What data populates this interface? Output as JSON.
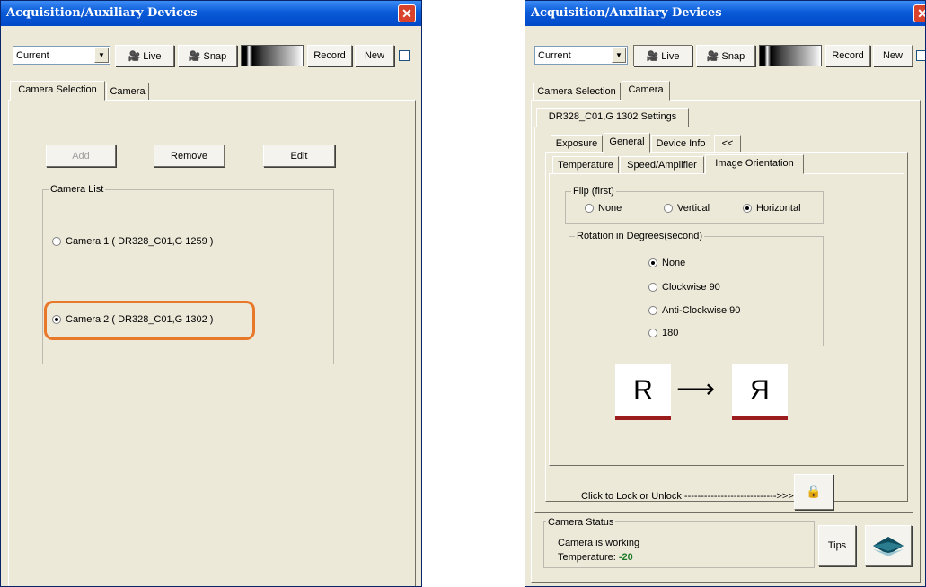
{
  "left": {
    "title": "Acquisition/Auxiliary Devices",
    "toolbar": {
      "combo_value": "Current",
      "live_label": "Live",
      "snap_label": "Snap",
      "record_label": "Record",
      "new_label": "New"
    },
    "tabs": [
      "Camera Selection",
      "Camera"
    ],
    "buttons": {
      "add": "Add",
      "remove": "Remove",
      "edit": "Edit"
    },
    "camera_list": {
      "caption": "Camera List",
      "items": [
        {
          "label": "Camera 1 ( DR328_C01,G 1259 )",
          "selected": false
        },
        {
          "label": "Camera 2 ( DR328_C01,G 1302 )",
          "selected": true
        }
      ]
    }
  },
  "right": {
    "title": "Acquisition/Auxiliary Devices",
    "toolbar": {
      "combo_value": "Current",
      "live_label": "Live",
      "snap_label": "Snap",
      "record_label": "Record",
      "new_label": "New"
    },
    "tabs": [
      "Camera Selection",
      "Camera"
    ],
    "settings_tab": "DR328_C01,G 1302 Settings",
    "subtabs": [
      "Exposure",
      "General",
      "Device Info",
      "<<"
    ],
    "subsubtabs": [
      "Temperature",
      "Speed/Amplifier",
      "Image Orientation"
    ],
    "flip": {
      "caption": "Flip (first)",
      "options": [
        "None",
        "Vertical",
        "Horizontal"
      ],
      "selected": "Horizontal"
    },
    "rotation": {
      "caption": "Rotation in Degrees(second)",
      "options": [
        "None",
        "Clockwise 90",
        "Anti-Clockwise 90",
        "180"
      ],
      "selected": "None"
    },
    "orientation_demo": {
      "from": "R",
      "arrow": "⟶",
      "to": "Я"
    },
    "lock_text": "Click to Lock or Unlock ---------------------------->>>",
    "status": {
      "caption": "Camera Status",
      "line1": "Camera is working",
      "temp_label": "Temperature:",
      "temp_value": "-20"
    },
    "tips_label": "Tips"
  },
  "colors": {
    "highlight": "#e8792a",
    "temperature": "#1d7a2a",
    "title_bar": "#0a5ad8"
  }
}
